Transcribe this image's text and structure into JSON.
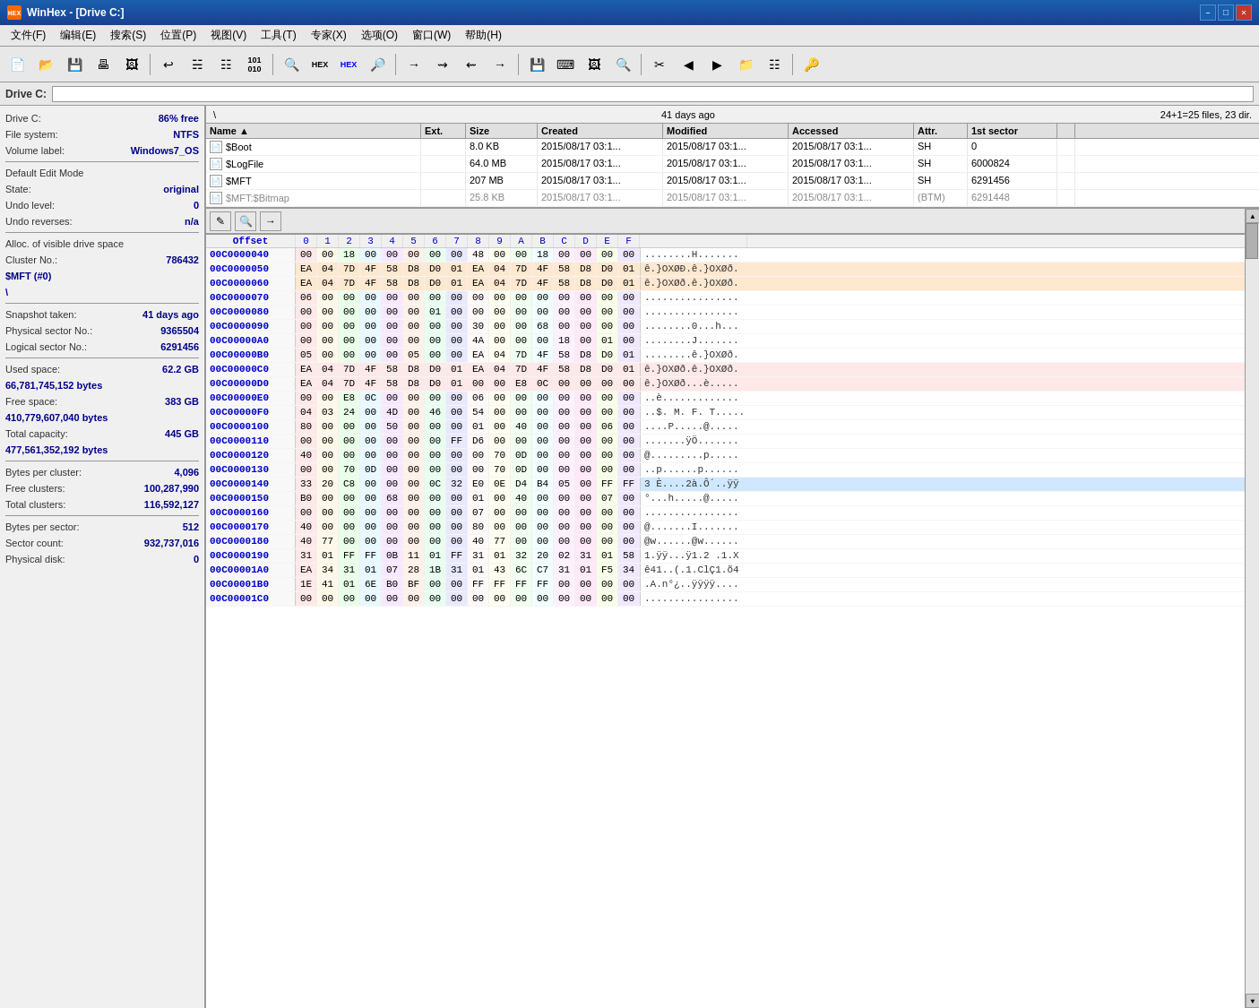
{
  "window": {
    "title": "WinHex - [Drive C:]",
    "titleIcon": "HEX"
  },
  "menu": {
    "items": [
      "文件(F)",
      "编辑(E)",
      "搜索(S)",
      "位置(P)",
      "视图(V)",
      "工具(T)",
      "专家(X)",
      "选项(O)",
      "窗口(W)",
      "帮助(H)"
    ]
  },
  "addressBar": {
    "label": "Drive C:",
    "value": ""
  },
  "topInfo": {
    "left": "\\",
    "center": "41 days ago",
    "right": "24+1=25 files, 23 dir."
  },
  "fileList": {
    "headers": [
      "Name",
      "Ext.",
      "Size",
      "Created",
      "Modified",
      "Accessed",
      "Attr.",
      "1st sector",
      ""
    ],
    "rows": [
      {
        "name": "$Boot",
        "ext": "",
        "size": "8.0 KB",
        "created": "2015/08/17 03:1...",
        "modified": "2015/08/17 03:1...",
        "accessed": "2015/08/17 03:1...",
        "attr": "SH",
        "sector": "0",
        "grayed": false
      },
      {
        "name": "$LogFile",
        "ext": "",
        "size": "64.0 MB",
        "created": "2015/08/17 03:1...",
        "modified": "2015/08/17 03:1...",
        "accessed": "2015/08/17 03:1...",
        "attr": "SH",
        "sector": "6000824",
        "grayed": false
      },
      {
        "name": "$MFT",
        "ext": "",
        "size": "207 MB",
        "created": "2015/08/17 03:1...",
        "modified": "2015/08/17 03:1...",
        "accessed": "2015/08/17 03:1...",
        "attr": "SH",
        "sector": "6291456",
        "grayed": false
      },
      {
        "name": "$MFT:$Bitmap",
        "ext": "",
        "size": "25.8 KB",
        "created": "2015/08/17 03:1...",
        "modified": "2015/08/17 03:1...",
        "accessed": "2015/08/17 03:1...",
        "attr": "(BTM)",
        "sector": "6291448",
        "grayed": true
      }
    ]
  },
  "infoPanel": {
    "driveLabel": "Drive C:",
    "driveFree": "86% free",
    "fsLabel": "File system:",
    "fsValue": "NTFS",
    "volLabel": "Volume label:",
    "volValue": "Windows7_OS",
    "editModeLabel": "Default Edit Mode",
    "stateLabel": "State:",
    "stateValue": "original",
    "undoLevelLabel": "Undo level:",
    "undoLevelValue": "0",
    "undoRevLabel": "Undo reverses:",
    "undoRevValue": "n/a",
    "allocLabel": "Alloc. of visible drive space",
    "clusterNoLabel": "Cluster No.:",
    "clusterNoValue": "786432",
    "mftLabel": "$MFT (#0)",
    "mftPath": "\\",
    "snapshotLabel": "Snapshot taken:",
    "snapshotValue": "41 days ago",
    "physSecLabel": "Physical sector No.:",
    "physSecValue": "9365504",
    "logSecLabel": "Logical sector No.:",
    "logSecValue": "6291456",
    "usedSpaceLabel": "Used space:",
    "usedSpaceValue": "62.2 GB",
    "usedSpaceBytes": "66,781,745,152 bytes",
    "freeSpaceLabel": "Free space:",
    "freeSpaceValue": "383 GB",
    "freeSpaceBytes": "410,779,607,040 bytes",
    "totalCapLabel": "Total capacity:",
    "totalCapValue": "445 GB",
    "totalCapBytes": "477,561,352,192 bytes",
    "bytesPerClusterLabel": "Bytes per cluster:",
    "bytesPerClusterValue": "4,096",
    "freeClustersLabel": "Free clusters:",
    "freeClustersValue": "100,287,990",
    "totalClustersLabel": "Total clusters:",
    "totalClustersValue": "116,592,127",
    "bytesPerSectorLabel": "Bytes per sector:",
    "bytesPerSectorValue": "512",
    "sectorCountLabel": "Sector count:",
    "sectorCountValue": "932,737,016",
    "physDiskLabel": "Physical disk:",
    "physDiskValue": "0"
  },
  "hexHeader": {
    "cols": [
      "Offset",
      "0",
      "1",
      "2",
      "3",
      "4",
      "5",
      "6",
      "7",
      "8",
      "9",
      "A",
      "B",
      "C",
      "D",
      "E",
      "F"
    ]
  },
  "hexRows": [
    {
      "offset": "00C0000040",
      "bytes": [
        "00",
        "00",
        "18",
        "00",
        "00",
        "00",
        "00",
        "00",
        "48",
        "00",
        "00",
        "18",
        "00",
        "00",
        "00",
        "00"
      ],
      "ascii": "........H.......",
      "bg": ""
    },
    {
      "offset": "00C0000050",
      "bytes": [
        "EA",
        "04",
        "7D",
        "4F",
        "58",
        "D8",
        "D0",
        "01",
        "EA",
        "04",
        "7D",
        "4F",
        "58",
        "D8",
        "D0",
        "01"
      ],
      "ascii": "ê.}OXØÐ.ê.}OXØð.",
      "bg": "orange"
    },
    {
      "offset": "00C0000060",
      "bytes": [
        "EA",
        "04",
        "7D",
        "4F",
        "58",
        "D8",
        "D0",
        "01",
        "EA",
        "04",
        "7D",
        "4F",
        "58",
        "D8",
        "D0",
        "01"
      ],
      "ascii": "ê.}OXØð.ê.}OXØð.",
      "bg": "orange"
    },
    {
      "offset": "00C0000070",
      "bytes": [
        "06",
        "00",
        "00",
        "00",
        "00",
        "00",
        "00",
        "00",
        "00",
        "00",
        "00",
        "00",
        "00",
        "00",
        "00",
        "00"
      ],
      "ascii": "................",
      "bg": ""
    },
    {
      "offset": "00C0000080",
      "bytes": [
        "00",
        "00",
        "00",
        "00",
        "00",
        "00",
        "01",
        "00",
        "00",
        "00",
        "00",
        "00",
        "00",
        "00",
        "00",
        "00"
      ],
      "ascii": "................",
      "bg": ""
    },
    {
      "offset": "00C0000090",
      "bytes": [
        "00",
        "00",
        "00",
        "00",
        "00",
        "00",
        "00",
        "00",
        "30",
        "00",
        "00",
        "68",
        "00",
        "00",
        "00",
        "00"
      ],
      "ascii": "........0...h...",
      "bg": ""
    },
    {
      "offset": "00C00000A0",
      "bytes": [
        "00",
        "00",
        "00",
        "00",
        "00",
        "00",
        "00",
        "00",
        "4A",
        "00",
        "00",
        "00",
        "18",
        "00",
        "01",
        "00"
      ],
      "ascii": "........J.......",
      "bg": ""
    },
    {
      "offset": "00C00000B0",
      "bytes": [
        "05",
        "00",
        "00",
        "00",
        "00",
        "05",
        "00",
        "00",
        "EA",
        "04",
        "7D",
        "4F",
        "58",
        "D8",
        "D0",
        "01"
      ],
      "ascii": "........ê.}OXØð.",
      "bg": ""
    },
    {
      "offset": "00C00000C0",
      "bytes": [
        "EA",
        "04",
        "7D",
        "4F",
        "58",
        "D8",
        "D0",
        "01",
        "EA",
        "04",
        "7D",
        "4F",
        "58",
        "D8",
        "D0",
        "01"
      ],
      "ascii": "ê.}OXØð.ê.}OXØð.",
      "bg": "pink"
    },
    {
      "offset": "00C00000D0",
      "bytes": [
        "EA",
        "04",
        "7D",
        "4F",
        "58",
        "D8",
        "D0",
        "01",
        "00",
        "00",
        "E8",
        "0C",
        "00",
        "00",
        "00",
        "00"
      ],
      "ascii": "ê.}OXØð...è.....",
      "bg": "pink"
    },
    {
      "offset": "00C00000E0",
      "bytes": [
        "00",
        "00",
        "E8",
        "0C",
        "00",
        "00",
        "00",
        "00",
        "06",
        "00",
        "00",
        "00",
        "00",
        "00",
        "00",
        "00"
      ],
      "ascii": "..è.............",
      "bg": ""
    },
    {
      "offset": "00C00000F0",
      "bytes": [
        "04",
        "03",
        "24",
        "00",
        "4D",
        "00",
        "46",
        "00",
        "54",
        "00",
        "00",
        "00",
        "00",
        "00",
        "00",
        "00"
      ],
      "ascii": "..$. M. F. T.....",
      "bg": ""
    },
    {
      "offset": "00C0000100",
      "bytes": [
        "80",
        "00",
        "00",
        "00",
        "50",
        "00",
        "00",
        "00",
        "01",
        "00",
        "40",
        "00",
        "00",
        "00",
        "06",
        "00"
      ],
      "ascii": "....P.....@.....",
      "bg": ""
    },
    {
      "offset": "00C0000110",
      "bytes": [
        "00",
        "00",
        "00",
        "00",
        "00",
        "00",
        "00",
        "FF",
        "D6",
        "00",
        "00",
        "00",
        "00",
        "00",
        "00",
        "00"
      ],
      "ascii": ".......ÿÖ.......",
      "bg": ""
    },
    {
      "offset": "00C0000120",
      "bytes": [
        "40",
        "00",
        "00",
        "00",
        "00",
        "00",
        "00",
        "00",
        "00",
        "70",
        "0D",
        "00",
        "00",
        "00",
        "00",
        "00"
      ],
      "ascii": "@.........p.....",
      "bg": ""
    },
    {
      "offset": "00C0000130",
      "bytes": [
        "00",
        "00",
        "70",
        "0D",
        "00",
        "00",
        "00",
        "00",
        "00",
        "70",
        "0D",
        "00",
        "00",
        "00",
        "00",
        "00"
      ],
      "ascii": "..p......p......",
      "bg": ""
    },
    {
      "offset": "00C0000140",
      "bytes": [
        "33",
        "20",
        "C8",
        "00",
        "00",
        "00",
        "0C",
        "32",
        "E0",
        "0E",
        "D4",
        "B4",
        "05",
        "00",
        "FF",
        "FF"
      ],
      "ascii": "3 È....2à.Ô´..ÿÿ",
      "bg": "highlight"
    },
    {
      "offset": "00C0000150",
      "bytes": [
        "B0",
        "00",
        "00",
        "00",
        "68",
        "00",
        "00",
        "00",
        "01",
        "00",
        "40",
        "00",
        "00",
        "00",
        "07",
        "00"
      ],
      "ascii": "°...h.....@.....",
      "bg": ""
    },
    {
      "offset": "00C0000160",
      "bytes": [
        "00",
        "00",
        "00",
        "00",
        "00",
        "00",
        "00",
        "00",
        "07",
        "00",
        "00",
        "00",
        "00",
        "00",
        "00",
        "00"
      ],
      "ascii": "................",
      "bg": ""
    },
    {
      "offset": "00C0000170",
      "bytes": [
        "40",
        "00",
        "00",
        "00",
        "00",
        "00",
        "00",
        "00",
        "80",
        "00",
        "00",
        "00",
        "00",
        "00",
        "00",
        "00"
      ],
      "ascii": "@.......I.......",
      "bg": ""
    },
    {
      "offset": "00C0000180",
      "bytes": [
        "40",
        "77",
        "00",
        "00",
        "00",
        "00",
        "00",
        "00",
        "40",
        "77",
        "00",
        "00",
        "00",
        "00",
        "00",
        "00"
      ],
      "ascii": "@w......@w......",
      "bg": ""
    },
    {
      "offset": "00C0000190",
      "bytes": [
        "31",
        "01",
        "FF",
        "FF",
        "0B",
        "11",
        "01",
        "FF",
        "31",
        "01",
        "32",
        "20",
        "02",
        "31",
        "01",
        "58"
      ],
      "ascii": "1.ÿÿ...ÿ1.2 .1.X",
      "bg": ""
    },
    {
      "offset": "00C00001A0",
      "bytes": [
        "EA",
        "34",
        "31",
        "01",
        "07",
        "28",
        "1B",
        "31",
        "01",
        "43",
        "6C",
        "C7",
        "31",
        "01",
        "F5",
        "34"
      ],
      "ascii": "ê41..(.1.ClÇ1.õ4",
      "bg": ""
    },
    {
      "offset": "00C00001B0",
      "bytes": [
        "1E",
        "41",
        "01",
        "6E",
        "B0",
        "BF",
        "00",
        "00",
        "FF",
        "FF",
        "FF",
        "FF",
        "00",
        "00",
        "00",
        "00"
      ],
      "ascii": ".A.n°¿..ÿÿÿÿ....",
      "bg": ""
    },
    {
      "offset": "00C00001C0",
      "bytes": [
        "00",
        "00",
        "00",
        "00",
        "00",
        "00",
        "00",
        "00",
        "00",
        "00",
        "00",
        "00",
        "00",
        "00",
        "00",
        "00"
      ],
      "ascii": "................",
      "bg": ""
    }
  ]
}
